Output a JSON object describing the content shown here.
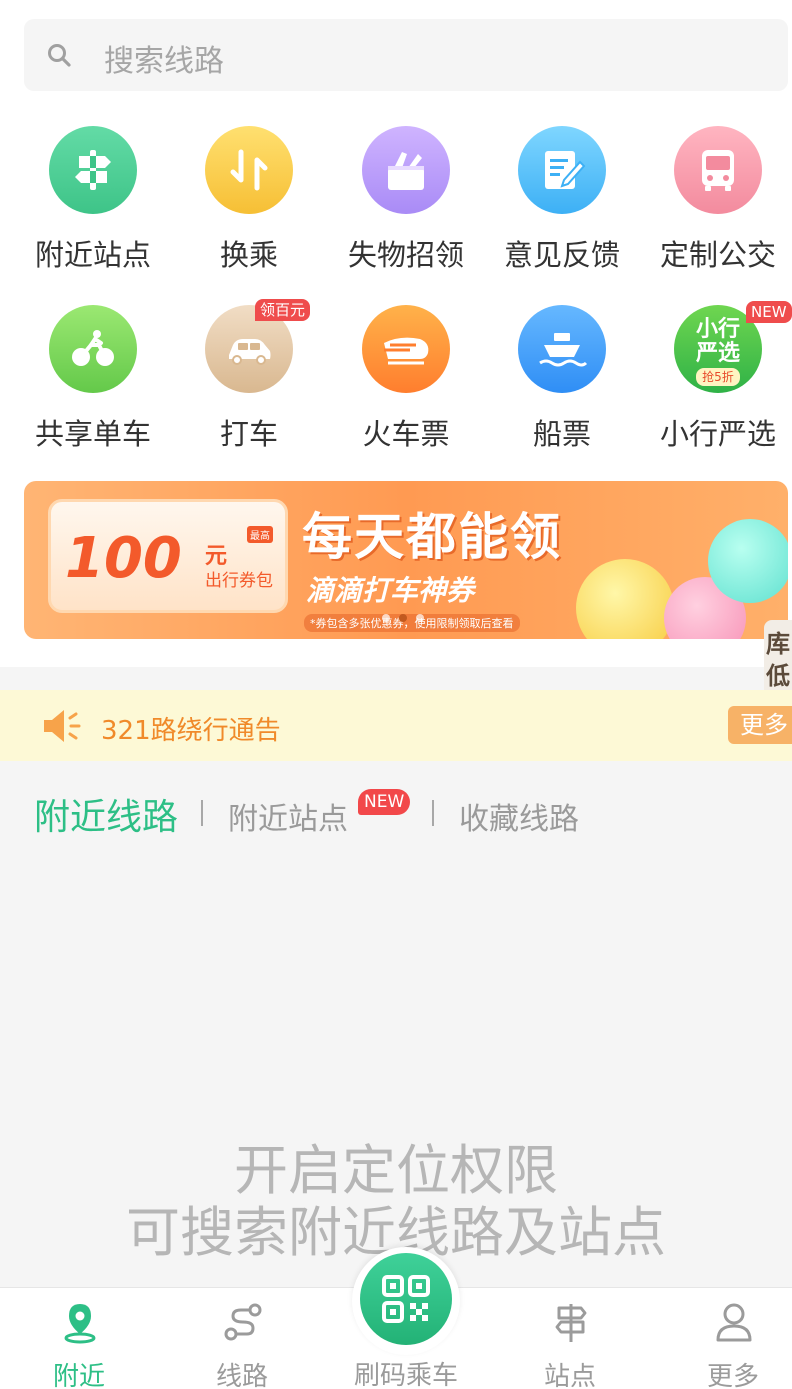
{
  "search": {
    "placeholder": "搜索线路",
    "icon": "search-icon"
  },
  "services": [
    {
      "label": "附近站点",
      "icon": "signpost-icon",
      "colors": [
        "#63dba6",
        "#3ec488"
      ]
    },
    {
      "label": "换乘",
      "icon": "transfer-arrows-icon",
      "colors": [
        "#ffe070",
        "#f6bf35"
      ]
    },
    {
      "label": "失物招领",
      "icon": "lost-found-box-icon",
      "colors": [
        "#cfb4ff",
        "#a98bf6"
      ]
    },
    {
      "label": "意见反馈",
      "icon": "feedback-edit-icon",
      "colors": [
        "#7fd6ff",
        "#3db0f5"
      ]
    },
    {
      "label": "定制公交",
      "icon": "bus-icon",
      "colors": [
        "#ffb5c1",
        "#f38b9e"
      ]
    },
    {
      "label": "共享单车",
      "icon": "bicycle-icon",
      "colors": [
        "#9be872",
        "#64c94a"
      ]
    },
    {
      "label": "打车",
      "icon": "car-icon",
      "colors": [
        "#f1ddc5",
        "#d9b890"
      ],
      "badge": "领百元"
    },
    {
      "label": "火车票",
      "icon": "train-icon",
      "colors": [
        "#ffb24a",
        "#ff7e2e"
      ]
    },
    {
      "label": "船票",
      "icon": "ship-icon",
      "colors": [
        "#66b8ff",
        "#2f8ef5"
      ]
    },
    {
      "label": "小行严选",
      "icon": "xiaoxing-select-icon",
      "colors": [
        "#6fd650",
        "#2fb247"
      ],
      "badge": "NEW",
      "icon_text_1": "小行",
      "icon_text_2": "严选",
      "icon_text_3": "抢5折"
    }
  ],
  "banner": {
    "coupon_amount": "100",
    "coupon_unit": "元",
    "coupon_sub": "出行券包",
    "coupon_tag": "最高",
    "headline": "每天都能领",
    "subline": "滴滴打车神券",
    "note": "*券包含多张优惠券，使用限制领取后查看",
    "page_count": 3,
    "active_page": 2
  },
  "side_tab": {
    "text": "库\n低"
  },
  "notice": {
    "text": "321路绕行通告",
    "more": "更多",
    "icon": "speaker-icon"
  },
  "tabs": [
    {
      "label": "附近线路",
      "active": true
    },
    {
      "label": "附近站点",
      "active": false,
      "badge": "NEW"
    },
    {
      "label": "收藏线路",
      "active": false
    }
  ],
  "empty": {
    "line1": "开启定位权限",
    "line2": "可搜索附近线路及站点"
  },
  "bottom_nav": [
    {
      "label": "附近",
      "icon": "location-pin-icon",
      "active": true
    },
    {
      "label": "线路",
      "icon": "route-icon",
      "active": false
    },
    {
      "label": "刷码乘车",
      "icon": "qr-code-icon",
      "active": false
    },
    {
      "label": "站点",
      "icon": "signpost-icon",
      "active": false
    },
    {
      "label": "更多",
      "icon": "user-icon",
      "active": false
    }
  ],
  "colors": {
    "accent": "#2dbf86",
    "notice_text": "#f08a2a",
    "badge_red": "#f2484a"
  }
}
